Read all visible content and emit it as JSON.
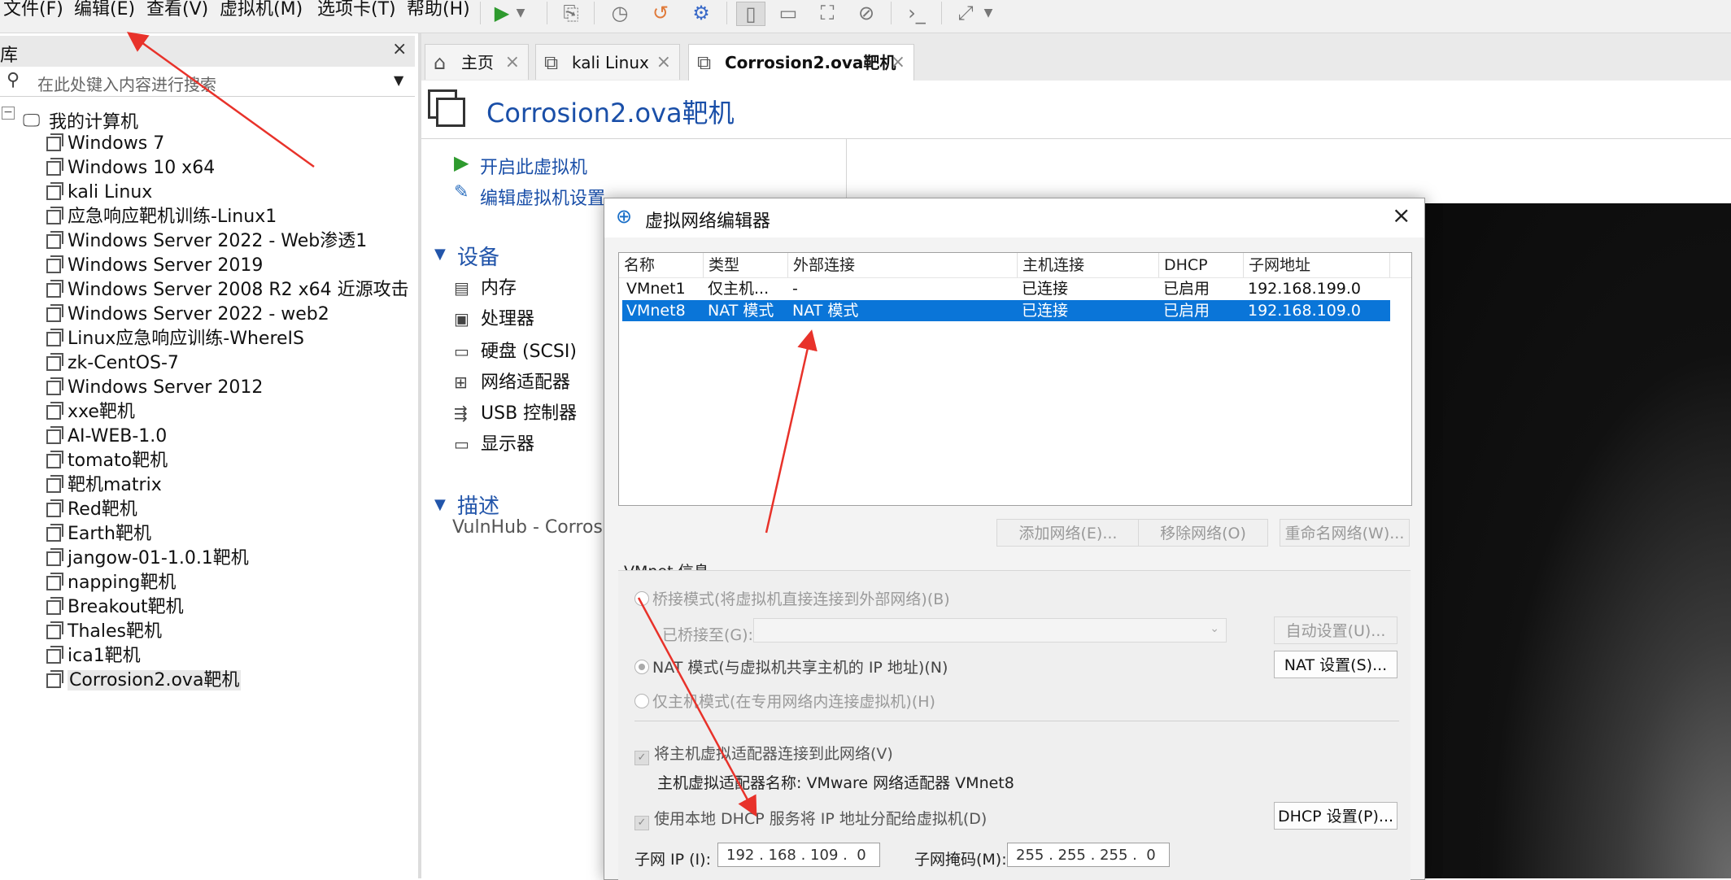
{
  "menu": {
    "items": [
      "文件(F)",
      "编辑(E)",
      "查看(V)",
      "虚拟机(M)",
      "选项卡(T)",
      "帮助(H)"
    ]
  },
  "library": {
    "title": "库",
    "search_placeholder": "在此处键入内容进行搜索",
    "root": "我的计算机",
    "vms": [
      "Windows 7",
      "Windows 10 x64",
      "kali Linux",
      "应急响应靶机训练-Linux1",
      "Windows Server 2022 - Web渗透1",
      "Windows Server 2019",
      "Windows Server 2008 R2 x64 近源攻击",
      "Windows Server 2022 - web2",
      "Linux应急响应训练-WhereIS",
      "zk-CentOS-7",
      "Windows Server 2012",
      "xxe靶机",
      "AI-WEB-1.0",
      "tomato靶机",
      "靶机matrix",
      "Red靶机",
      "Earth靶机",
      "jangow-01-1.0.1靶机",
      "napping靶机",
      "Breakout靶机",
      "Thales靶机",
      "ica1靶机",
      "Corrosion2.ova靶机"
    ],
    "selected": "Corrosion2.ova靶机"
  },
  "tabs": [
    {
      "label": "主页",
      "icon": "home-icon"
    },
    {
      "label": "kali Linux",
      "icon": "vm-icon"
    },
    {
      "label": "Corrosion2.ova靶机",
      "icon": "vm-icon"
    }
  ],
  "vm": {
    "title": "Corrosion2.ova靶机",
    "actions": {
      "power_on": "开启此虚拟机",
      "edit": "编辑虚拟机设置"
    },
    "devices_heading": "设备",
    "devices": [
      "内存",
      "处理器",
      "硬盘 (SCSI)",
      "网络适配器",
      "USB 控制器",
      "显示器"
    ],
    "desc_heading": "描述",
    "desc_text": "VulnHub - Corrosio"
  },
  "dialog": {
    "title": "虚拟网络编辑器",
    "close": "×",
    "columns": [
      "名称",
      "类型",
      "外部连接",
      "主机连接",
      "DHCP",
      "子网地址"
    ],
    "rows": [
      {
        "name": "VMnet1",
        "type": "仅主机...",
        "external": "-",
        "host": "已连接",
        "dhcp": "已启用",
        "subnet": "192.168.199.0"
      },
      {
        "name": "VMnet8",
        "type": "NAT 模式",
        "external": "NAT 模式",
        "host": "已连接",
        "dhcp": "已启用",
        "subnet": "192.168.109.0"
      }
    ],
    "buttons": {
      "add": "添加网络(E)...",
      "remove": "移除网络(O)",
      "rename": "重命名网络(W)..."
    },
    "info_title": "VMnet 信息",
    "bridge": "桥接模式(将虚拟机直接连接到外部网络)(B)",
    "bridge_to": "已桥接至(G):",
    "auto": "自动设置(U)...",
    "nat": "NAT 模式(与虚拟机共享主机的 IP 地址)(N)",
    "nat_settings": "NAT 设置(S)...",
    "hostonly": "仅主机模式(在专用网络内连接虚拟机)(H)",
    "connect_adapter": "将主机虚拟适配器连接到此网络(V)",
    "adapter_name": "主机虚拟适配器名称: VMware 网络适配器 VMnet8",
    "dhcp_service": "使用本地 DHCP 服务将 IP 地址分配给虚拟机(D)",
    "dhcp_settings": "DHCP 设置(P)...",
    "subnet_ip_label": "子网 IP (I):",
    "subnet_ip": "192 . 168 . 109 .  0",
    "subnet_mask_label": "子网掩码(M):",
    "subnet_mask": "255 . 255 . 255 .  0"
  },
  "colors": {
    "accent": "#0a75d8",
    "link": "#1a4fa8",
    "annotation": "#e8322a"
  }
}
